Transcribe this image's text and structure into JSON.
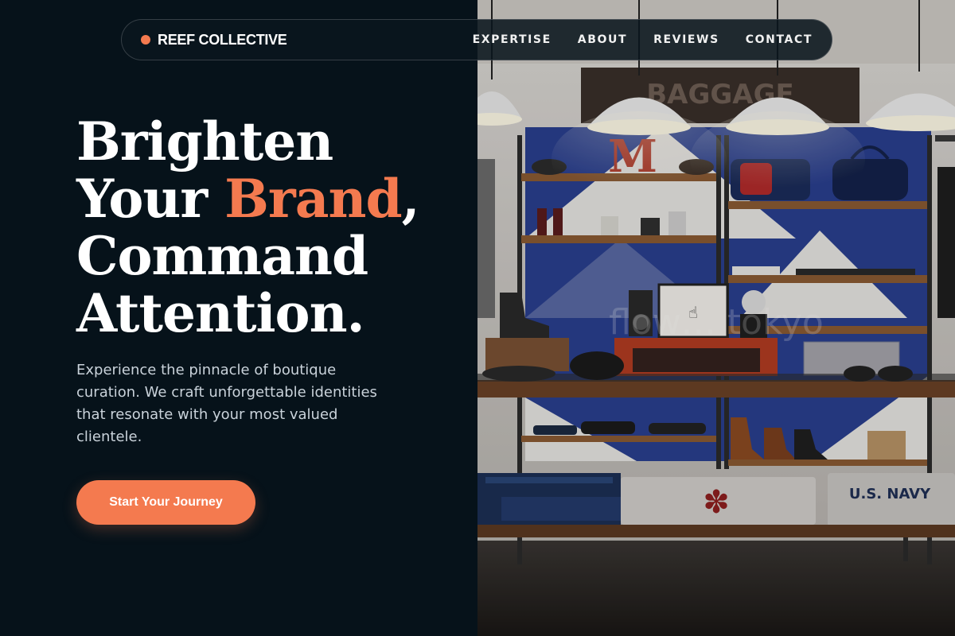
{
  "brand": {
    "name": "REEF COLLECTIVE",
    "accent_color": "#f47a4f"
  },
  "nav": {
    "links": [
      "EXPERTISE",
      "ABOUT",
      "REVIEWS",
      "CONTACT"
    ]
  },
  "hero": {
    "headline_line1": "Brighten",
    "headline_line2_start": "Your ",
    "headline_line2_accent": "Brand",
    "headline_line2_end": ",",
    "headline_line3": "Command",
    "headline_line4": "Attention.",
    "intro": "Experience the pinnacle of boutique curation. We craft unforgettable identities that resonate with your most valued clientele.",
    "cta_label": "Start Your Journey",
    "image_subject": "boutique-store-interior-photo",
    "image_sign_text": "BAGGAGE",
    "image_watermark": "flow… tokyo",
    "image_shelf_letter": "M",
    "image_folded_shirt_text": "U.S. NAVY"
  },
  "colors": {
    "background": "#06121a",
    "accent": "#f47a4f",
    "text_primary": "#ffffff",
    "text_secondary": "#c9d2da"
  }
}
